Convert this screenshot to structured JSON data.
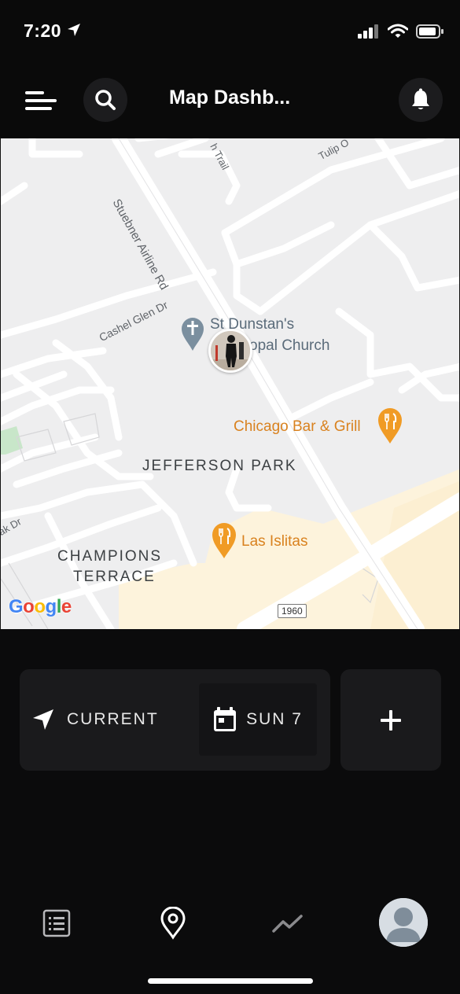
{
  "status_bar": {
    "time": "7:20"
  },
  "header": {
    "title": "Map Dashb..."
  },
  "map": {
    "streets": {
      "stuebner": "Stuebner Airline Rd",
      "cashel": "Cashel Glen Dr",
      "tulip": "Tulip O",
      "trail": "h Trail",
      "oak": "ak Dr"
    },
    "areas": {
      "jefferson": "JEFFERSON PARK",
      "champions_1": "CHAMPIONS",
      "champions_2": "TERRACE"
    },
    "pois": {
      "church_1": "St Dunstan's",
      "church_2": "opal Church",
      "chicago": "Chicago Bar & Grill",
      "islitas": "Las Islitas"
    },
    "route_shield": "1960",
    "attribution": "Google",
    "colors": {
      "food": "#f09b25",
      "church": "#7b8f9f",
      "park": "#c8e6c9",
      "commercial": "#fdf3dc",
      "road": "#ffffff"
    }
  },
  "controls": {
    "current_label": "CURRENT",
    "date_label": "SUN 7",
    "add_symbol": "+"
  },
  "tabs": {
    "items": [
      "list",
      "map",
      "stats",
      "profile"
    ],
    "active": "map"
  },
  "icons": {
    "status": [
      "location-arrow-icon",
      "signal-icon",
      "wifi-icon",
      "battery-icon"
    ],
    "header": [
      "menu-icon",
      "search-icon",
      "bell-icon"
    ],
    "controls": [
      "navigation-arrow-icon",
      "calendar-icon",
      "plus-icon"
    ],
    "tabbar": [
      "list-icon",
      "map-pin-icon",
      "trend-icon",
      "avatar-icon"
    ]
  }
}
